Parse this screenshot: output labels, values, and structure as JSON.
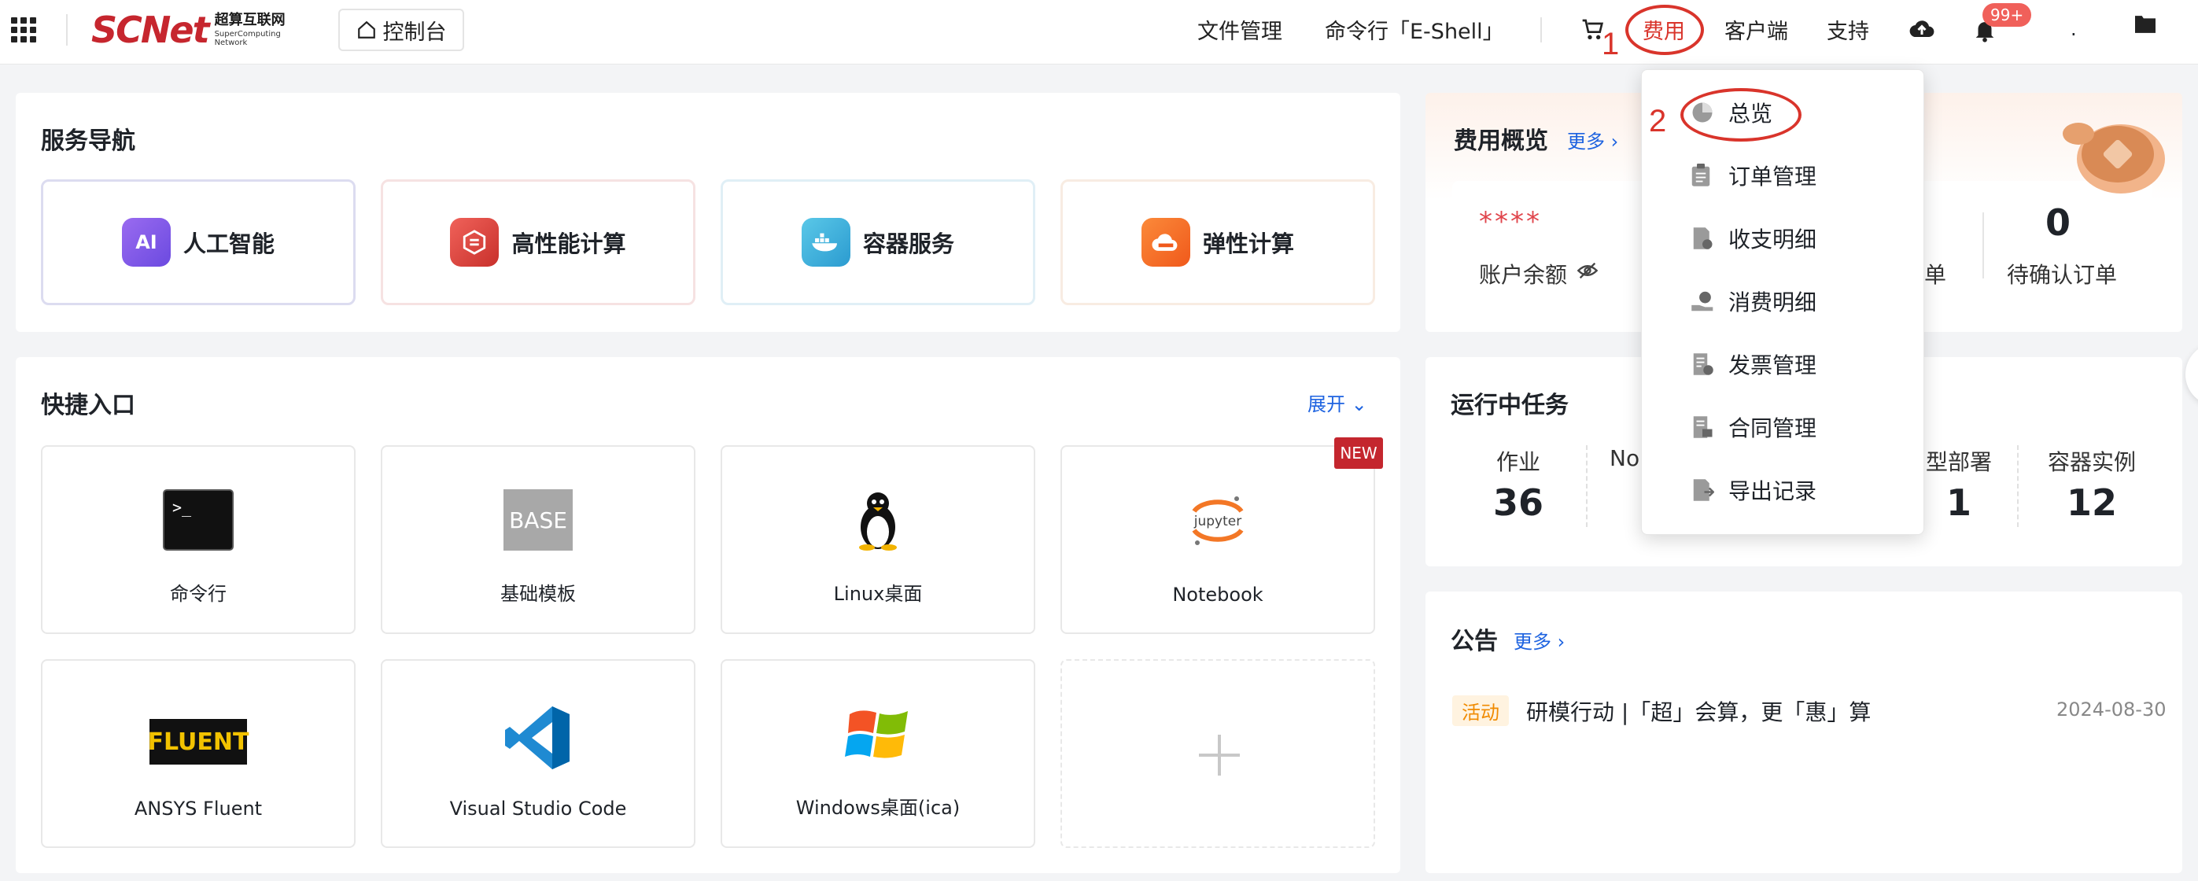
{
  "header": {
    "logo_main": "SCNet",
    "logo_cn": "超算互联网",
    "logo_en": "SuperComputing Network",
    "console": "控制台",
    "nav": [
      "文件管理",
      "命令行「E-Shell」",
      "费用",
      "客户端",
      "支持"
    ],
    "notification_count": "99+"
  },
  "annotations": {
    "step1": "1",
    "step2": "2"
  },
  "service_nav": {
    "title": "服务导航",
    "items": [
      {
        "label": "人工智能",
        "icon": "ai-icon"
      },
      {
        "label": "高性能计算",
        "icon": "hpc-icon"
      },
      {
        "label": "容器服务",
        "icon": "docker-icon"
      },
      {
        "label": "弹性计算",
        "icon": "cloud-icon"
      }
    ]
  },
  "quick_entry": {
    "title": "快捷入口",
    "expand": "展开",
    "new_tag": "NEW",
    "items": [
      {
        "label": "命令行"
      },
      {
        "label": "基础模板",
        "art_text": "BASE"
      },
      {
        "label": "Linux桌面"
      },
      {
        "label": "Notebook",
        "art_text": "jupyter"
      },
      {
        "label": "ANSYS Fluent",
        "art_text": "FLUENT"
      },
      {
        "label": "Visual Studio Code"
      },
      {
        "label": "Windows桌面(ica)"
      }
    ]
  },
  "fee_overview": {
    "title": "费用概览",
    "more": "更多",
    "balance_mask": "****",
    "balance_label": "账户余额",
    "partial_label": "订单",
    "pending_value": "0",
    "pending_label": "待确认订单"
  },
  "running_tasks": {
    "title": "运行中任务",
    "stats": [
      {
        "label": "作业",
        "value": "36"
      },
      {
        "label": "No",
        "value": ""
      },
      {
        "label": "型部署",
        "value": "1"
      },
      {
        "label": "容器实例",
        "value": "12"
      }
    ]
  },
  "announcement": {
    "title": "公告",
    "more": "更多",
    "tag": "活动",
    "text": "研模行动 |「超」会算，更「惠」算",
    "date": "2024-08-30"
  },
  "fee_menu": {
    "items": [
      "总览",
      "订单管理",
      "收支明细",
      "消费明细",
      "发票管理",
      "合同管理",
      "导出记录"
    ]
  },
  "colors": {
    "brand": "#c6262e",
    "link": "#1e63e0",
    "annotation": "#d9342b"
  }
}
